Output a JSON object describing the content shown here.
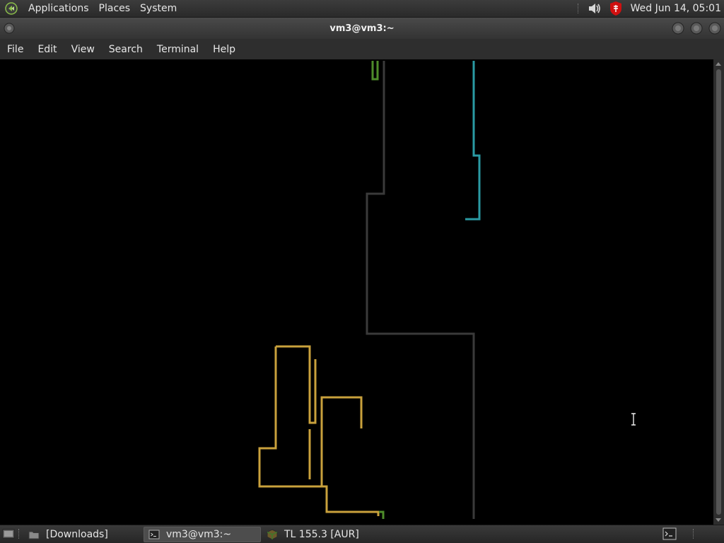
{
  "top_panel": {
    "menus": [
      {
        "label": "Applications"
      },
      {
        "label": "Places"
      },
      {
        "label": "System"
      }
    ],
    "clock": "Wed Jun 14, 05:01",
    "tray_icons": [
      "volume-icon",
      "security-shield-icon"
    ]
  },
  "window": {
    "title": "vm3@vm3:~"
  },
  "menubar": {
    "items": [
      {
        "label": "File"
      },
      {
        "label": "Edit"
      },
      {
        "label": "View"
      },
      {
        "label": "Search"
      },
      {
        "label": "Terminal"
      },
      {
        "label": "Help"
      }
    ]
  },
  "terminal": {
    "pipes": [
      {
        "color": "#4e8c2a"
      },
      {
        "color": "#3a3a3a"
      },
      {
        "color": "#2a9aa3"
      },
      {
        "color": "#c9a13c"
      }
    ]
  },
  "taskbar": {
    "tasks": [
      {
        "label": "[Downloads]",
        "icon": "folder-icon",
        "active": false
      },
      {
        "label": "vm3@vm3:~",
        "icon": "terminal-icon",
        "active": true
      },
      {
        "label": "TL 155.3 [AUR]",
        "icon": "package-icon",
        "active": false
      }
    ]
  },
  "colors": {
    "panel": "#333333",
    "pipe_green": "#4e8c2a",
    "pipe_gray": "#3a3a3a",
    "pipe_teal": "#2a9aa3",
    "pipe_gold": "#c9a13c"
  }
}
